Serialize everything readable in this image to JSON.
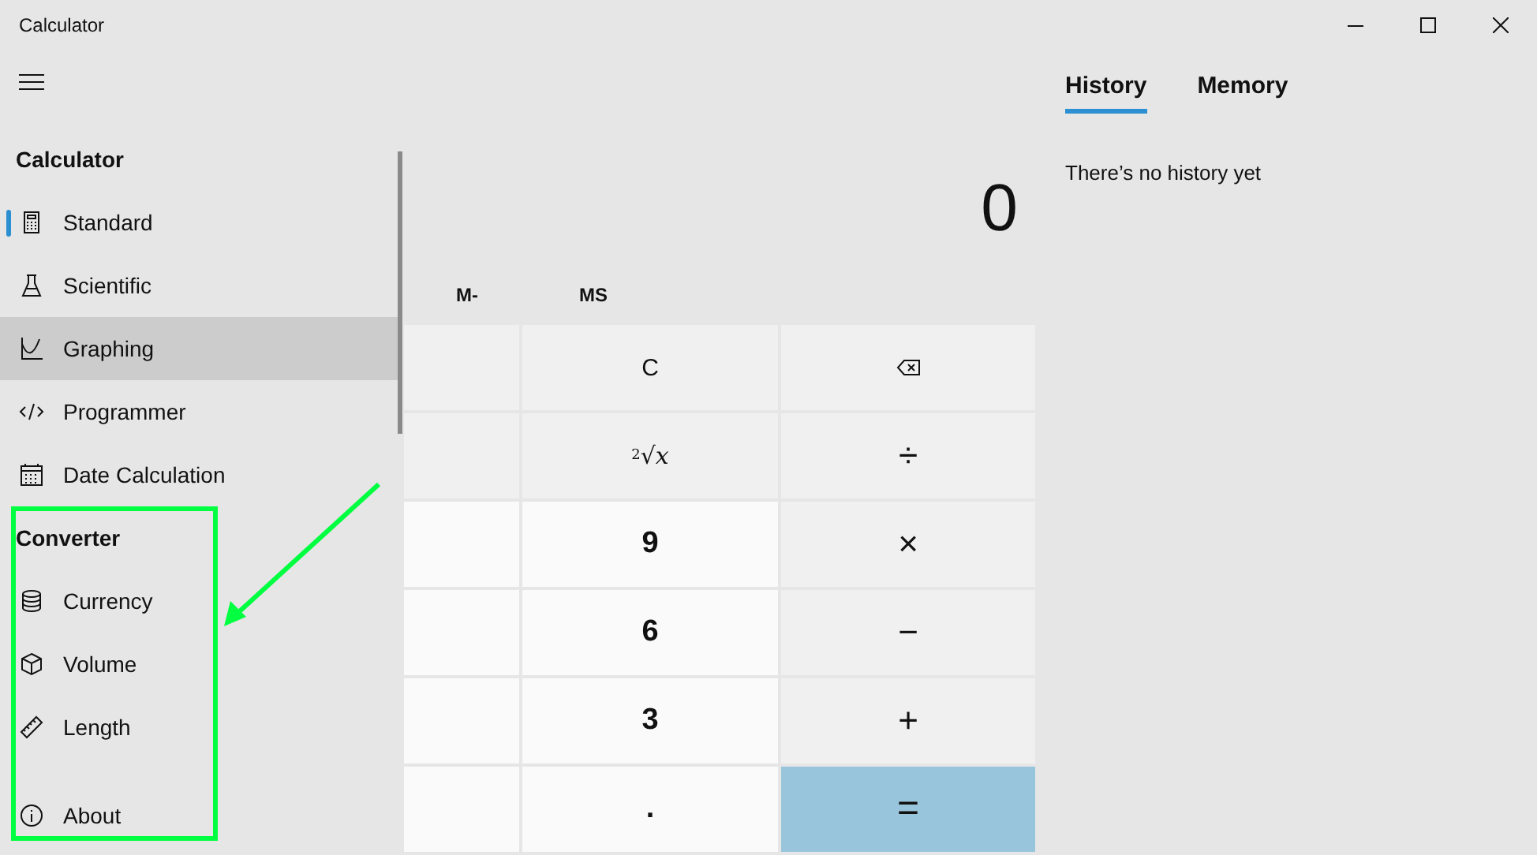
{
  "window": {
    "title": "Calculator"
  },
  "nav": {
    "sections": [
      {
        "heading": "Calculator",
        "items": [
          {
            "label": "Standard",
            "kind": "standard",
            "selected": true,
            "hovered": false
          },
          {
            "label": "Scientific",
            "kind": "scientific",
            "selected": false,
            "hovered": false
          },
          {
            "label": "Graphing",
            "kind": "graphing",
            "selected": false,
            "hovered": true
          },
          {
            "label": "Programmer",
            "kind": "programmer",
            "selected": false,
            "hovered": false
          },
          {
            "label": "Date Calculation",
            "kind": "date",
            "selected": false,
            "hovered": false
          }
        ]
      },
      {
        "heading": "Converter",
        "items": [
          {
            "label": "Currency",
            "kind": "currency",
            "selected": false,
            "hovered": false
          },
          {
            "label": "Volume",
            "kind": "volume",
            "selected": false,
            "hovered": false
          },
          {
            "label": "Length",
            "kind": "length",
            "selected": false,
            "hovered": false
          }
        ]
      }
    ],
    "footer_item": {
      "label": "About",
      "kind": "about"
    }
  },
  "display": {
    "value": "0"
  },
  "memory_buttons": [
    "M-",
    "MS"
  ],
  "keypad": [
    [
      {
        "kind": "function"
      },
      {
        "kind": "function",
        "label": "C"
      },
      {
        "kind": "backspace"
      }
    ],
    [
      {
        "kind": "function"
      },
      {
        "kind": "function",
        "label": "$^{2}$√*x*"
      },
      {
        "kind": "operator",
        "label": "÷"
      }
    ],
    [
      {
        "kind": "digit"
      },
      {
        "kind": "digit",
        "label": "9"
      },
      {
        "kind": "operator",
        "label": "×"
      }
    ],
    [
      {
        "kind": "digit"
      },
      {
        "kind": "digit",
        "label": "6"
      },
      {
        "kind": "operator",
        "label": "−"
      }
    ],
    [
      {
        "kind": "digit"
      },
      {
        "kind": "digit",
        "label": "3"
      },
      {
        "kind": "operator",
        "label": "+"
      }
    ],
    [
      {
        "kind": "digit"
      },
      {
        "kind": "digit",
        "label": "."
      },
      {
        "kind": "equals",
        "label": "="
      }
    ]
  ],
  "history": {
    "tabs": [
      {
        "label": "History",
        "selected": true
      },
      {
        "label": "Memory",
        "selected": false
      }
    ],
    "empty_text": "There’s no history yet"
  },
  "annotation": {
    "frame": true,
    "arrow": true
  }
}
